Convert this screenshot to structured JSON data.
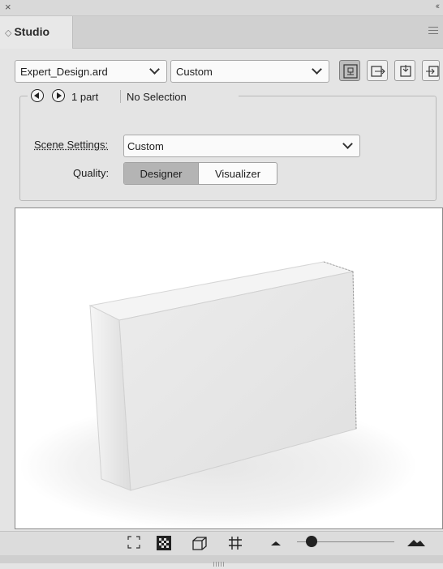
{
  "panel": {
    "close_glyph": "×",
    "collapse_glyph": "‹‹",
    "tab_icon": "◇",
    "tab_label": "Studio",
    "menu_icon": "hamburger-menu-icon"
  },
  "file_select": {
    "value": "Expert_Design.ard"
  },
  "preset_select": {
    "value": "Custom"
  },
  "view_buttons": [
    {
      "name": "view-mode-1-icon",
      "active": true
    },
    {
      "name": "view-mode-2-icon",
      "active": false
    },
    {
      "name": "view-mode-3-icon",
      "active": false
    },
    {
      "name": "view-mode-4-icon",
      "active": false
    }
  ],
  "navigation": {
    "part_count": "1 part",
    "selection": "No Selection"
  },
  "scene": {
    "label": "Scene Settings:",
    "value": "Custom"
  },
  "quality": {
    "label": "Quality:",
    "options": [
      "Designer",
      "Visualizer"
    ],
    "selected": "Designer"
  },
  "bottom_toolbar": {
    "icons": [
      "fit-view-icon",
      "checkerboard-icon",
      "box-view-icon",
      "grid-icon",
      "small-mountain-icon",
      "large-mountain-icon"
    ],
    "zoom_slider_level": 0.15
  },
  "colors": {
    "panel_bg": "#e4e4e4",
    "active_segment": "#b4b4b4",
    "viewport_bg": "#ffffff"
  }
}
